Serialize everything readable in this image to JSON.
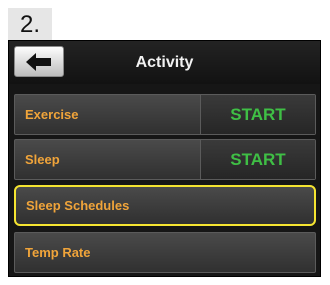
{
  "step_label": "2.",
  "screen": {
    "title": "Activity",
    "back_icon": "back-arrow-icon"
  },
  "menu": {
    "exercise": {
      "label": "Exercise",
      "action": "START"
    },
    "sleep": {
      "label": "Sleep",
      "action": "START"
    },
    "sleep_schedules": {
      "label": "Sleep Schedules",
      "highlighted": true
    },
    "temp_rate": {
      "label": "Temp Rate"
    }
  },
  "colors": {
    "label": "#f0a43a",
    "start": "#3fbf45",
    "highlight": "#f5e431",
    "background": "#161616"
  }
}
